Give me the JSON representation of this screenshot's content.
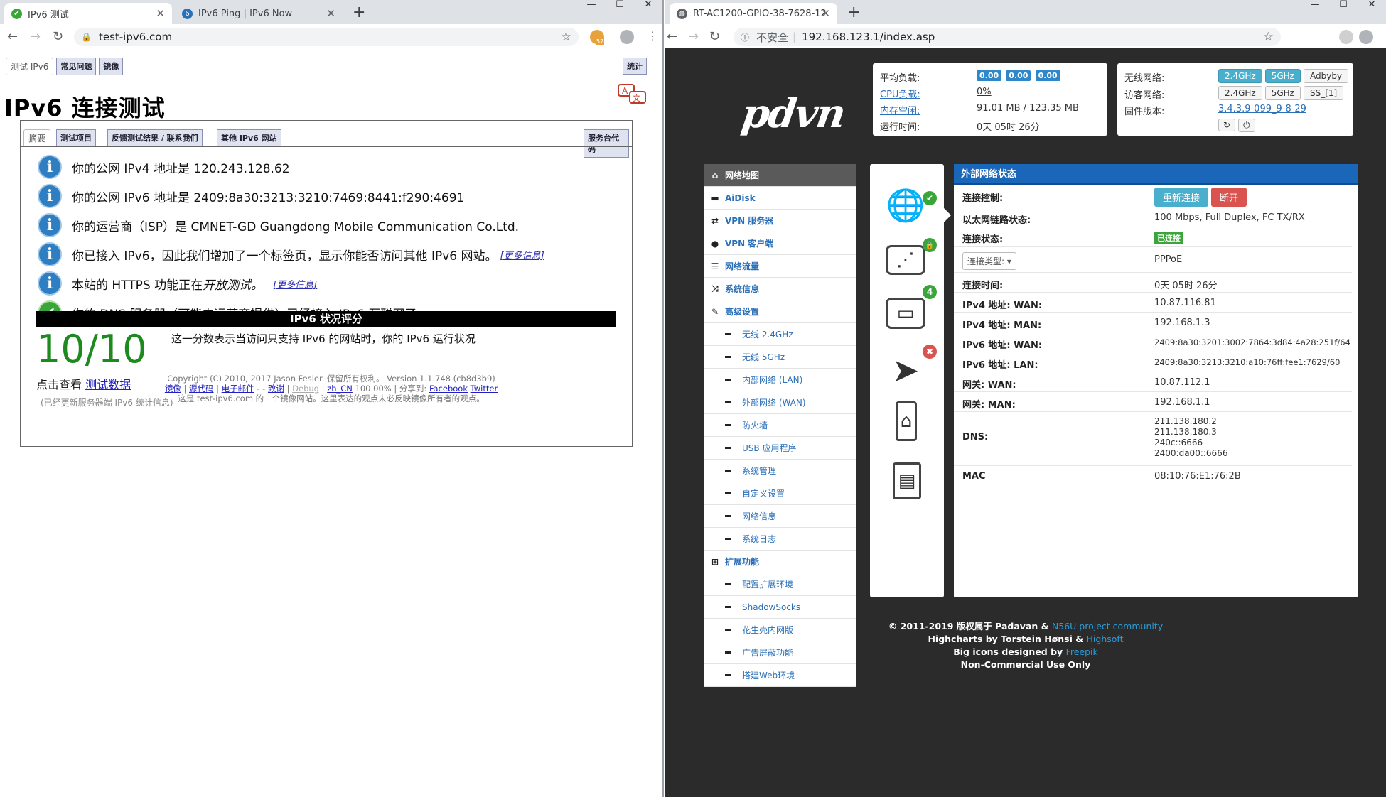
{
  "left": {
    "tabs": [
      {
        "title": "IPv6 测试"
      },
      {
        "title": "IPv6 Ping | IPv6 Now"
      }
    ],
    "url": "test-ipv6.com",
    "ext_badge": "57",
    "page_tabs": [
      "测试 IPv6",
      "常见问题",
      "镜像"
    ],
    "stats_tab": "统计",
    "title": "IPv6 连接测试",
    "subtabs": [
      "摘要",
      "测试项目",
      "反馈测试结果 / 联系我们",
      "其他 IPv6 网站"
    ],
    "mirror_tab": "服务台代码",
    "results": [
      {
        "text": "你的公网 IPv4 地址是 120.243.128.62",
        "icon": "info-icon"
      },
      {
        "text": "你的公网 IPv6 地址是 2409:8a30:3213:3210:7469:8441:f290:4691",
        "icon": "info-icon"
      },
      {
        "text": "你的运营商（ISP）是 CMNET-GD Guangdong Mobile Communication Co.Ltd.",
        "icon": "info-icon"
      },
      {
        "text": "你已接入 IPv6，因此我们增加了一个标签页，显示你能否访问其他 IPv6 网站。",
        "more": "[更多信息]",
        "icon": "info-icon"
      },
      {
        "text_a": "本站的 HTTPS 功能正在",
        "text_b": "开放测试。",
        "more": "[更多信息]",
        "icon": "info-icon"
      },
      {
        "text": "你的 DNS 服务器（可能由运营商提供）已经接入 IPv6 互联网了。",
        "icon": "check-icon"
      }
    ],
    "score_bar": "IPv6 状况评分",
    "score": "10/10",
    "score_desc": "这一分数表示当访问只支持 IPv6 的网站时，你的 IPv6 运行状况",
    "click_text": "点击查看",
    "click_link": "测试数据",
    "note": "(已经更新服务器端 IPv6 统计信息)",
    "footer_line1": "Copyright (C) 2010, 2017 Jason Fesler. 保留所有权利。 Version 1.1.748 (cb8d3b9)",
    "footer_links": [
      "镜像",
      "源代码",
      "电子邮件",
      "致谢",
      "Debug",
      "zh_CN",
      "Facebook",
      "Twitter"
    ],
    "footer_misc": [
      "|",
      "|",
      "-",
      "-",
      ". . .",
      "|",
      "100.00% | 分享到:"
    ],
    "footer_line3": "这是 test-ipv6.com 的一个镜像网站。这里表达的观点未必反映镜像所有者的观点。"
  },
  "right": {
    "tab_title": "RT-AC1200-GPIO-38-7628-12",
    "insecure": "不安全",
    "url": "192.168.123.1/index.asp",
    "logo": "pdvn",
    "status": {
      "load_label": "平均负载:",
      "load": [
        "0.00",
        "0.00",
        "0.00"
      ],
      "cpu_label": "CPU负载:",
      "cpu": "0%",
      "mem_label": "内存空闲:",
      "mem": "91.01 MB / 123.35 MB",
      "uptime_label": "运行时间:",
      "uptime": "0天 05时 26分"
    },
    "wifi": {
      "wlan_label": "无线网络:",
      "wlan": [
        "2.4GHz",
        "5GHz",
        "Adbyby"
      ],
      "guest_label": "访客网络:",
      "guest": [
        "2.4GHz",
        "5GHz",
        "SS_[1]"
      ],
      "fw_label": "固件版本:",
      "fw": "3.4.3.9-099_9-8-29"
    },
    "menu": [
      {
        "label": "网络地图",
        "type": "head",
        "icon": "home-icon"
      },
      {
        "label": "AiDisk",
        "type": "bold",
        "icon": "hdd-icon"
      },
      {
        "label": "VPN 服务器",
        "type": "bold",
        "icon": "retweet-icon"
      },
      {
        "label": "VPN 客户端",
        "type": "bold",
        "icon": "globe-icon"
      },
      {
        "label": "网络流量",
        "type": "bold",
        "icon": "list-icon"
      },
      {
        "label": "系统信息",
        "type": "bold",
        "icon": "random-icon"
      },
      {
        "label": "高级设置",
        "type": "bold",
        "icon": "wrench-icon"
      },
      {
        "label": "无线 2.4GHz",
        "type": "sub"
      },
      {
        "label": "无线 5GHz",
        "type": "sub"
      },
      {
        "label": "内部网络 (LAN)",
        "type": "sub"
      },
      {
        "label": "外部网络 (WAN)",
        "type": "sub"
      },
      {
        "label": "防火墙",
        "type": "sub"
      },
      {
        "label": "USB 应用程序",
        "type": "sub"
      },
      {
        "label": "系统管理",
        "type": "sub"
      },
      {
        "label": "自定义设置",
        "type": "sub"
      },
      {
        "label": "网络信息",
        "type": "sub"
      },
      {
        "label": "系统日志",
        "type": "sub"
      },
      {
        "label": "扩展功能",
        "type": "bold",
        "icon": "grid-icon"
      },
      {
        "label": "配置扩展环境",
        "type": "sub"
      },
      {
        "label": "ShadowSocks",
        "type": "sub"
      },
      {
        "label": "花生壳内网版",
        "type": "sub"
      },
      {
        "label": "广告屏蔽功能",
        "type": "sub"
      },
      {
        "label": "搭建Web环境",
        "type": "sub"
      }
    ],
    "devices": [
      {
        "name": "internet",
        "badge": "✔",
        "badge_color": "#3aa63a"
      },
      {
        "name": "wireless",
        "badge": "🔒",
        "badge_color": "#3aa63a"
      },
      {
        "name": "clients",
        "badge": "4",
        "badge_color": "#3aa63a"
      },
      {
        "name": "wan",
        "badge": "✖",
        "badge_color": "#d9534f"
      },
      {
        "name": "usb",
        "badge": "",
        "badge_color": ""
      },
      {
        "name": "sdcard",
        "badge": "",
        "badge_color": ""
      }
    ],
    "wan_title": "外部网络状态",
    "wan_rows": [
      {
        "label": "连接控制:",
        "type": "buttons",
        "buttons": [
          "重新连接",
          "断开"
        ]
      },
      {
        "label": "以太网链路状态:",
        "value": "100 Mbps, Full Duplex, FC TX/RX"
      },
      {
        "label": "连接状态:",
        "type": "badge",
        "value": "已连接"
      },
      {
        "label": "连接类型:",
        "type": "select",
        "value": "PPPoE"
      },
      {
        "label": "连接时间:",
        "value": "0天 05时 26分"
      },
      {
        "label": "IPv4 地址: WAN:",
        "value": "10.87.116.81"
      },
      {
        "label": "IPv4 地址: MAN:",
        "value": "192.168.1.3"
      },
      {
        "label": "IPv6 地址: WAN:",
        "value": "2409:8a30:3201:3002:7864:3d84:4a28:251f/64"
      },
      {
        "label": "IPv6 地址: LAN:",
        "value": "2409:8a30:3213:3210:a10:76ff:fee1:7629/60"
      },
      {
        "label": "网关: WAN:",
        "value": "10.87.112.1"
      },
      {
        "label": "网关: MAN:",
        "value": "192.168.1.1"
      },
      {
        "label": "DNS:",
        "type": "multi",
        "values": [
          "211.138.180.2",
          "211.138.180.3",
          "240c::6666",
          "2400:da00::6666"
        ]
      },
      {
        "label": "MAC",
        "value": "08:10:76:E1:76:2B"
      }
    ],
    "footer": {
      "l1a": "© 2011-2019 版权属于 Padavan &",
      "l1b": "N56U project community",
      "l2a": "Highcharts by Torstein Hønsi &",
      "l2b": "Highsoft",
      "l3a": "Big icons designed by",
      "l3b": "Freepik",
      "l4": "Non-Commercial Use Only"
    }
  },
  "colors": {
    "accent": "#1a66b8",
    "ok": "#3aa63a",
    "danger": "#d9534f",
    "info": "#2f7ec1",
    "score": "#1d8a1d"
  }
}
